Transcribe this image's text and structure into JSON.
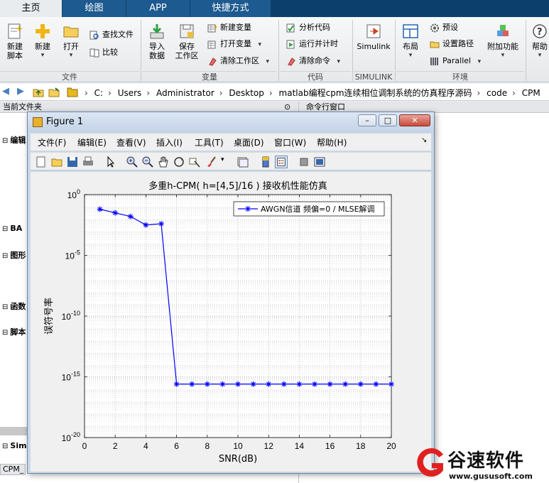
{
  "ribbon_tabs": [
    "主页",
    "绘图",
    "APP",
    "快捷方式"
  ],
  "ribbon": {
    "new_script": "新建\n脚本",
    "new": "新建",
    "open": "打开",
    "find_files": "查找文件",
    "compare": "比较",
    "file_section": "文件",
    "import_data": "导入\n数据",
    "save_workspace": "保存\n工作区",
    "new_variable": "新建变量",
    "open_variable": "打开变量",
    "clear_workspace": "清除工作区",
    "variable_section": "变量",
    "analyze_code": "分析代码",
    "run_and_time": "运行并计时",
    "clear_commands": "清除命令",
    "code_section": "代码",
    "simulink": "Simulink",
    "simulink_section": "SIMULINK",
    "layout": "布局",
    "preferences": "预设",
    "set_path": "设置路径",
    "parallel": "Parallel",
    "environment_section": "环境",
    "add_ons": "附加功能",
    "help": "帮助"
  },
  "breadcrumbs": [
    "C:",
    "Users",
    "Administrator",
    "Desktop",
    "matlab编程cpm连续相位调制系统的仿真程序源码",
    "code",
    "CPM"
  ],
  "left_panel": {
    "title": "当前文件夹",
    "items": [
      "编辑",
      "BA",
      "图形",
      "函数",
      "脚本",
      "Sim"
    ],
    "bottom_tab": "CPM_"
  },
  "right_panel": {
    "title": "命令行窗口"
  },
  "figure": {
    "title": "Figure 1",
    "menu": [
      "文件(F)",
      "编辑(E)",
      "查看(V)",
      "插入(I)",
      "工具(T)",
      "桌面(D)",
      "窗口(W)",
      "帮助(H)"
    ]
  },
  "chart_data": {
    "type": "line",
    "title": "多重h-CPM( h=[4,5]/16 ) 接收机性能仿真",
    "xlabel": "SNR(dB)",
    "ylabel": "误符号率",
    "xlim": [
      0,
      20
    ],
    "ylim_exp": [
      -20,
      0
    ],
    "yscale": "log",
    "xticks": [
      0,
      2,
      4,
      6,
      8,
      10,
      12,
      14,
      16,
      18,
      20
    ],
    "yticks_exp": [
      0,
      -5,
      -10,
      -15,
      -20
    ],
    "grid": true,
    "legend_position": "top-right",
    "series": [
      {
        "name": "AWGN信道 频偏=0 / MLSE解调",
        "color": "#0000ff",
        "marker": "asterisk",
        "x": [
          1,
          2,
          3,
          4,
          5,
          6,
          7,
          8,
          9,
          10,
          11,
          12,
          13,
          14,
          15,
          16,
          17,
          18,
          19,
          20
        ],
        "y_exp": [
          -1.2,
          -1.5,
          -1.8,
          -2.5,
          -2.4,
          -15.6,
          -15.6,
          -15.6,
          -15.6,
          -15.6,
          -15.6,
          -15.6,
          -15.6,
          -15.6,
          -15.6,
          -15.6,
          -15.6,
          -15.6,
          -15.6,
          -15.6
        ]
      }
    ]
  },
  "watermark": {
    "text": "谷速软件",
    "url": "www.gususoft.com"
  }
}
